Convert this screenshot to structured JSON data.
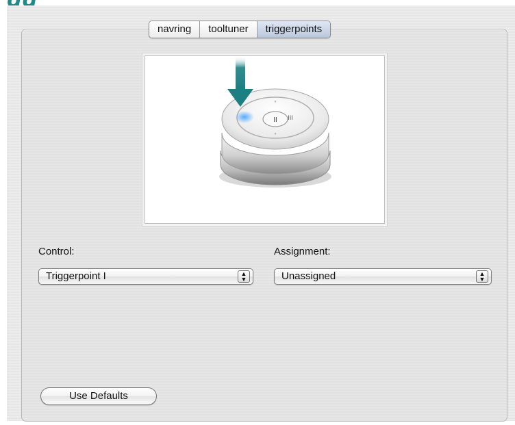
{
  "tabs": [
    {
      "label": "navring",
      "active": false
    },
    {
      "label": "tooltuner",
      "active": false
    },
    {
      "label": "triggerpoints",
      "active": true
    }
  ],
  "controls": {
    "control_label": "Control:",
    "control_value": "Triggerpoint I",
    "assignment_label": "Assignment:",
    "assignment_value": "Unassigned"
  },
  "buttons": {
    "use_defaults": "Use Defaults"
  },
  "colors": {
    "accent_teal": "#1f8a8a",
    "arrow_teal": "#1c7f82",
    "highlight_blue": "#4aa8ff"
  },
  "icons": {
    "stepper": "up-down-stepper-icon",
    "device": "shuttle-device-icon",
    "arrow": "down-arrow-icon"
  }
}
